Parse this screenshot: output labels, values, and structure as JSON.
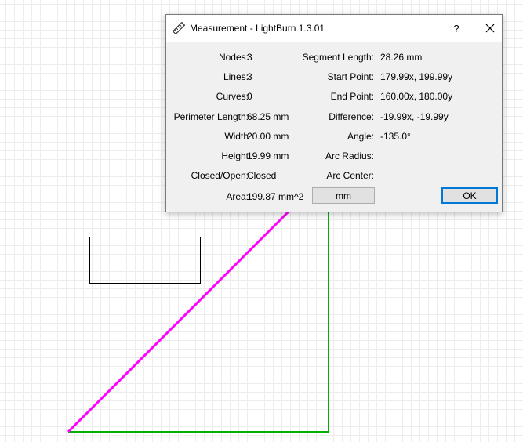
{
  "dialog": {
    "title": "Measurement - LightBurn 1.3.01",
    "help_label": "?",
    "icons": {
      "title": "ruler-icon",
      "close": "close-icon"
    },
    "left_fields": [
      {
        "label": "Nodes:",
        "value": "3"
      },
      {
        "label": "Lines:",
        "value": "3"
      },
      {
        "label": "Curves:",
        "value": "0"
      },
      {
        "label": "Perimeter Length:",
        "value": "68.25 mm"
      },
      {
        "label": "Width",
        "value": "20.00 mm"
      },
      {
        "label": "Height",
        "value": "19.99 mm"
      },
      {
        "label": "Closed/Open:",
        "value": "Closed"
      },
      {
        "label": "Area:",
        "value": "199.87 mm^2"
      }
    ],
    "right_fields": [
      {
        "label": "Segment Length:",
        "value": "28.26 mm"
      },
      {
        "label": "Start Point:",
        "value": "179.99x, 199.99y"
      },
      {
        "label": "End Point:",
        "value": "160.00x, 180.00y"
      },
      {
        "label": "Difference:",
        "value": "-19.99x, -19.99y"
      },
      {
        "label": "Angle:",
        "value": "-135.0°"
      },
      {
        "label": "Arc Radius:",
        "value": ""
      },
      {
        "label": "Arc Center:",
        "value": ""
      }
    ],
    "unit_button": "mm",
    "ok_button": "OK"
  },
  "colors": {
    "selected_segment": "#ff00ff",
    "shape_outline": "#00b000",
    "rectangle_outline": "#000000",
    "ok_border": "#0078d7"
  }
}
